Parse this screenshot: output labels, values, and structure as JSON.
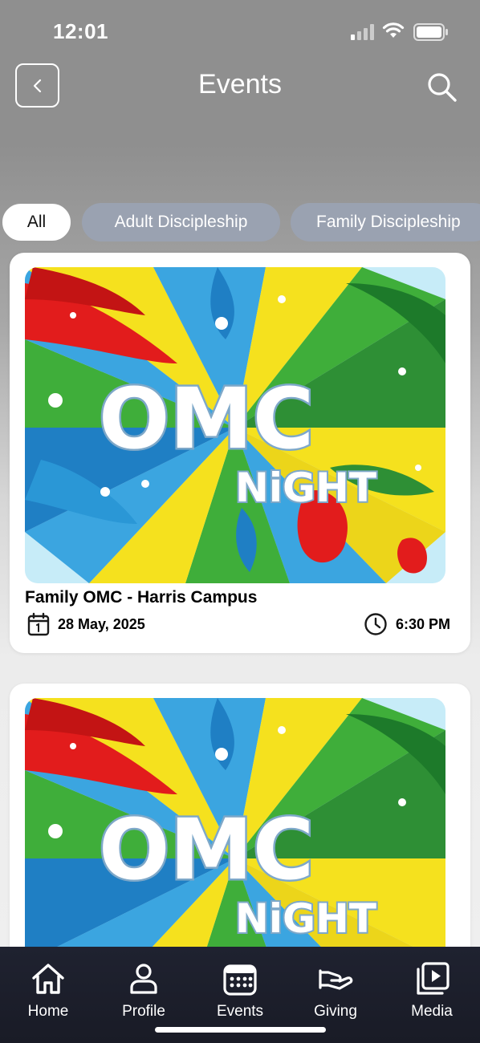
{
  "status_bar": {
    "time": "12:01"
  },
  "header": {
    "title": "Events"
  },
  "filters": [
    {
      "label": "All",
      "active": true
    },
    {
      "label": "Adult Discipleship",
      "active": false
    },
    {
      "label": "Family Discipleship",
      "active": false
    }
  ],
  "events": [
    {
      "title": "Family OMC - Harris Campus",
      "date": "28 May, 2025",
      "time": "6:30 PM",
      "art_text_1": "OMC",
      "art_text_2": "NiGHT"
    },
    {
      "title": "",
      "date": "",
      "time": "",
      "art_text_1": "OMC",
      "art_text_2": "NiGHT"
    }
  ],
  "tabs": [
    {
      "label": "Home",
      "icon": "home-icon"
    },
    {
      "label": "Profile",
      "icon": "person-icon"
    },
    {
      "label": "Events",
      "icon": "calendar-icon"
    },
    {
      "label": "Giving",
      "icon": "giving-hand-icon"
    },
    {
      "label": "Media",
      "icon": "media-play-icon"
    }
  ],
  "colors": {
    "tab_bar": "#1f2230",
    "chip_inactive": "#9aa2b1",
    "chip_active": "#ffffff",
    "art_red": "#e21c1c",
    "art_yellow": "#f5e11e",
    "art_green": "#3fae3a",
    "art_blue": "#3ba5e0",
    "art_sky": "#c7ecf8"
  }
}
